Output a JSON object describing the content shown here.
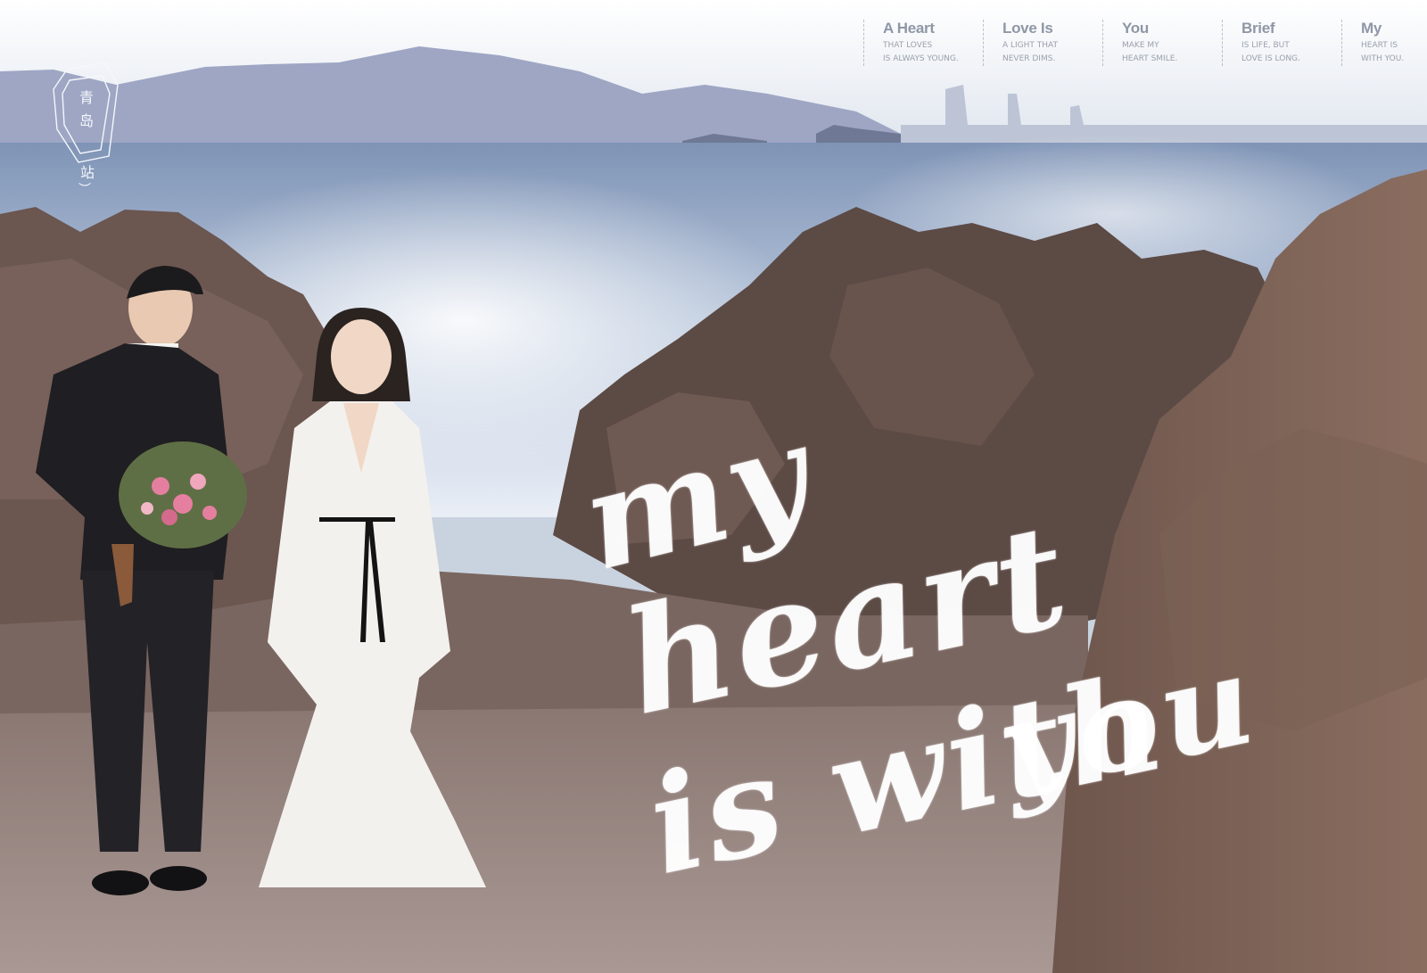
{
  "badge": {
    "chars": [
      "青",
      "岛",
      "站"
    ],
    "bracket_open": "︵",
    "bracket_close": "︶"
  },
  "quotes": [
    {
      "title": "A Heart",
      "line1": "THAT LOVES",
      "line2": "IS ALWAYS YOUNG."
    },
    {
      "title": "Love Is",
      "line1": "A LIGHT THAT",
      "line2": "NEVER DIMS."
    },
    {
      "title": "You",
      "line1": "MAKE MY",
      "line2": "HEART SMILE."
    },
    {
      "title": "Brief",
      "line1": "IS LIFE, BUT",
      "line2": "LOVE IS LONG."
    },
    {
      "title": "My",
      "line1": "HEART IS",
      "line2": "WITH YOU."
    }
  ],
  "headline": {
    "line1": "my",
    "line2": "heart",
    "line3": "is with",
    "line4": "you"
  },
  "colors": {
    "sky": "#dfe5ee",
    "sea": "#8fa4c4",
    "rock": "#5b4a45",
    "sand": "#9b8a85",
    "suit": "#1f1e22",
    "dress": "#f3f1ee"
  }
}
